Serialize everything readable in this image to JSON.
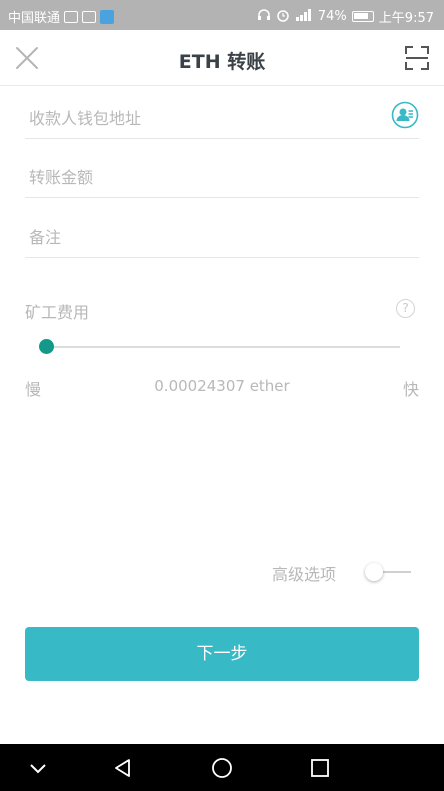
{
  "status_bar": {
    "carrier": "中国联通",
    "battery": "74%",
    "time": "上午9:57"
  },
  "header": {
    "title": "ETH 转账"
  },
  "form": {
    "address_placeholder": "收款人钱包地址",
    "amount_placeholder": "转账金额",
    "memo_placeholder": "备注"
  },
  "fee": {
    "label": "矿工费用",
    "help_glyph": "?",
    "slow_label": "慢",
    "fast_label": "快",
    "value": "0.00024307 ether",
    "slider_level": 0.0
  },
  "advanced": {
    "label": "高级选项",
    "enabled": false
  },
  "next_button": {
    "label": "下一步"
  },
  "colors": {
    "accent": "#38b9c6",
    "slider_thumb": "#13988a",
    "placeholder": "#b8b8b8"
  }
}
